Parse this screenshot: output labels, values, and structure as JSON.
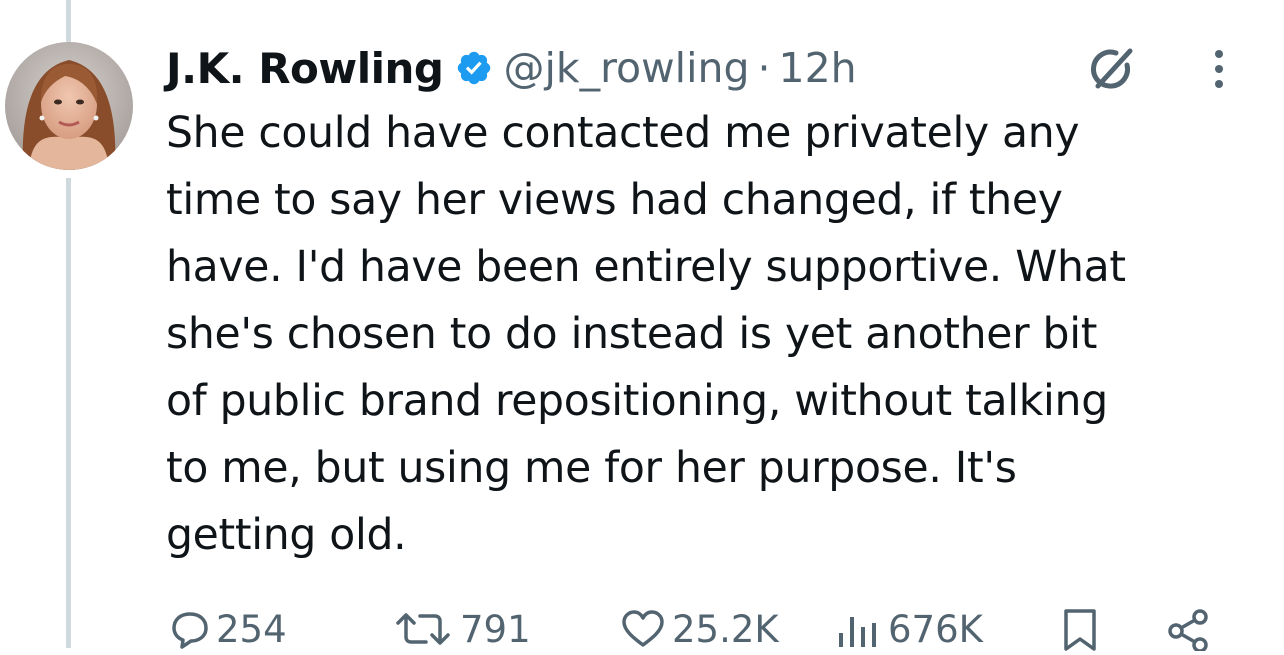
{
  "author": {
    "display_name": "J.K. Rowling",
    "handle": "@jk_rowling",
    "separator": "·",
    "timestamp": "12h",
    "verified": true
  },
  "tweet": {
    "lines": [
      "She could have contacted me privately any",
      "time to say her views had changed, if they",
      "have. I'd have been entirely supportive. What",
      "she's chosen to do instead is yet another bit",
      "of public brand repositioning, without talking",
      "to me, but using me for her purpose. It's",
      "getting old."
    ]
  },
  "actions": {
    "replies": "254",
    "reposts": "791",
    "likes": "25.2K",
    "views": "676K"
  },
  "icons": {
    "verified": "verified-badge-icon",
    "grok": "grok-icon",
    "more": "more-vertical-icon",
    "reply": "reply-icon",
    "repost": "repost-icon",
    "like": "heart-icon",
    "views": "views-icon",
    "bookmark": "bookmark-icon",
    "share": "share-icon"
  },
  "colors": {
    "verified": "#1d9bf0",
    "text": "#0f1419",
    "secondary": "#536471",
    "thread_line": "#cfd9de"
  }
}
